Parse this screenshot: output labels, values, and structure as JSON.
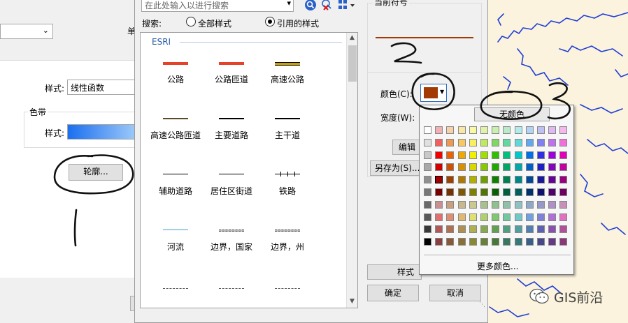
{
  "left_dialog": {
    "unit_label_partial": "单",
    "style_label": "样式:",
    "style_value": "线性函数",
    "color_band_group": "色带",
    "color_band_style_label": "样式:",
    "outline_button": "轮廓..."
  },
  "symbol_selector": {
    "search_placeholder": "在此处输入以进行搜索",
    "search_label": "搜索:",
    "radio_all": "全部样式",
    "radio_referenced": "引用的样式",
    "group_name": "ESRI",
    "symbols": [
      {
        "label": "公路",
        "color": "#e8412a"
      },
      {
        "label": "公路匝道",
        "color": "#e8412a"
      },
      {
        "label": "高速公路",
        "color": "#c8a000"
      },
      {
        "label": "高速公路匝道",
        "color": "#5a4a2a"
      },
      {
        "label": "主要道路",
        "color": "#000000"
      },
      {
        "label": "主干道",
        "color": "#000000"
      },
      {
        "label": "辅助道路",
        "color": "#000000"
      },
      {
        "label": "居住区街道",
        "color": "#000000"
      },
      {
        "label": "铁路",
        "color": "#000000"
      },
      {
        "label": "河流",
        "color": "#3aa0c8"
      },
      {
        "label": "边界，国家",
        "color": "#555555"
      },
      {
        "label": "边界，州",
        "color": "#555555"
      }
    ],
    "current_symbol_label_partial": "当前符号",
    "color_label": "颜色(C):",
    "current_color": "#a33a06",
    "width_label": "宽度(W):",
    "edit_button_partial": "编辑符",
    "save_as_button": "另存为(S)...",
    "style_manager_partial": "样式引",
    "ok_button": "确定",
    "cancel_button": "取消"
  },
  "color_palette": {
    "no_color": "无颜色",
    "more_colors": "更多颜色...",
    "rows": [
      [
        "#ffffff",
        "#f4b0b0",
        "#f7d2a8",
        "#fbe7a4",
        "#fbf8a4",
        "#e0f4a8",
        "#c8f0b0",
        "#b8ecc8",
        "#b0ecec",
        "#b0d4f4",
        "#c0c0f4",
        "#e0b8f4",
        "#f4b8ec"
      ],
      [
        "#e0e0e0",
        "#f06060",
        "#f09850",
        "#f8c860",
        "#f8f060",
        "#c0e860",
        "#80d860",
        "#60d8a0",
        "#60d8d8",
        "#60a8f0",
        "#8080f0",
        "#c070f0",
        "#f070d8"
      ],
      [
        "#c8c8c8",
        "#f00000",
        "#f06000",
        "#f0a800",
        "#f0f000",
        "#a0e000",
        "#30c000",
        "#00c080",
        "#00c8c8",
        "#0070e8",
        "#3030e0",
        "#a000e0",
        "#e000b8"
      ],
      [
        "#a8a8a8",
        "#d00000",
        "#d05000",
        "#d89000",
        "#d8d800",
        "#88c800",
        "#20a800",
        "#00a868",
        "#00a8a8",
        "#0060c8",
        "#2020c0",
        "#8800c0",
        "#c000a0"
      ],
      [
        "#909090",
        "#a00000",
        "#a04000",
        "#b07800",
        "#b0b000",
        "#70a000",
        "#108000",
        "#008050",
        "#008888",
        "#004898",
        "#181898",
        "#680098",
        "#980080"
      ],
      [
        "#787878",
        "#780000",
        "#783000",
        "#805800",
        "#808000",
        "#507800",
        "#086000",
        "#006040",
        "#006060",
        "#003070",
        "#101070",
        "#500070",
        "#700060"
      ],
      [
        "#686868",
        "#c89090",
        "#c8a080",
        "#c8b890",
        "#c8c890",
        "#a8c090",
        "#90c090",
        "#90c0a8",
        "#90c0c0",
        "#90a8c8",
        "#9898c8",
        "#b090c8",
        "#c890b8"
      ],
      [
        "#585858",
        "#e07070",
        "#e09070",
        "#e0b870",
        "#e0e070",
        "#b0d070",
        "#80c870",
        "#70c8a0",
        "#70c8c8",
        "#70a0e0",
        "#8080d8",
        "#b070d8",
        "#e070c0"
      ],
      [
        "#383838",
        "#b05858",
        "#b07050",
        "#b09050",
        "#b0b050",
        "#88a850",
        "#60a050",
        "#50a080",
        "#50a0a0",
        "#5080b0",
        "#6060b0",
        "#8850b0",
        "#b05098"
      ],
      [
        "#000000",
        "#884040",
        "#885838",
        "#887038",
        "#888838",
        "#688038",
        "#487838",
        "#387860",
        "#387878",
        "#386088",
        "#484888",
        "#683888",
        "#883878"
      ]
    ]
  },
  "watermark": "GIS前沿",
  "annotations": {
    "number_two": "2",
    "number_one": "1"
  }
}
